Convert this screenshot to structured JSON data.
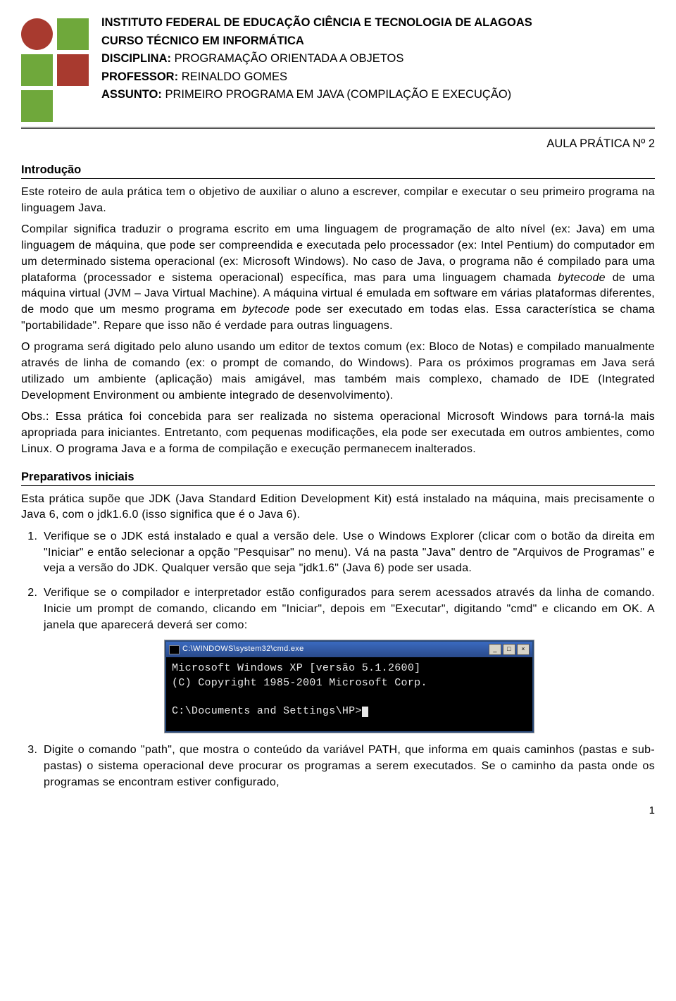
{
  "header": {
    "line1_bold": "INSTITUTO FEDERAL DE EDUCAÇÃO CIÊNCIA E TECNOLOGIA DE ALAGOAS",
    "line2_bold": "CURSO TÉCNICO EM INFORMÁTICA",
    "line3_label": "DISCIPLINA:",
    "line3_value": " PROGRAMAÇÃO ORIENTADA A OBJETOS",
    "line4_label": "PROFESSOR:",
    "line4_value": " REINALDO GOMES",
    "line5_label": "ASSUNTO:",
    "line5_value": " PRIMEIRO PROGRAMA EM JAVA (COMPILAÇÃO E EXECUÇÃO)"
  },
  "lesson_title": "AULA PRÁTICA Nº 2",
  "sections": {
    "intro_title": "Introdução",
    "intro_p1": "Este roteiro de aula prática tem o objetivo de auxiliar o aluno a escrever, compilar e executar o seu primeiro programa na linguagem Java.",
    "intro_p2a": "Compilar significa traduzir o programa escrito em uma linguagem de programação de alto nível (ex: Java) em uma linguagem de máquina, que pode ser compreendida e executada pelo processador (ex: Intel Pentium) do computador em um determinado sistema operacional (ex: Microsoft Windows). No caso de Java, o programa não é compilado para uma plataforma (processador e sistema operacional) específica, mas para uma linguagem chamada ",
    "intro_p2_ital1": "bytecode",
    "intro_p2b": " de uma máquina virtual (JVM – Java Virtual Machine). A máquina virtual é emulada em software em várias plataformas diferentes, de modo que um mesmo programa em ",
    "intro_p2_ital2": "bytecode",
    "intro_p2c": " pode ser executado em todas elas. Essa característica se chama \"portabilidade\". Repare que isso não é verdade para outras linguagens.",
    "intro_p3": "O programa será digitado pelo aluno usando um editor de textos comum (ex: Bloco de Notas) e compilado manualmente através de linha de comando (ex: o prompt de comando, do Windows). Para os próximos programas em Java será utilizado um ambiente (aplicação) mais amigável, mas também mais complexo, chamado de IDE (Integrated Development Environment ou ambiente integrado de desenvolvimento).",
    "intro_p4": "Obs.: Essa prática foi concebida para ser realizada no sistema operacional Microsoft Windows para torná-la mais apropriada para iniciantes. Entretanto, com pequenas modificações, ela pode ser executada em outros ambientes, como Linux. O programa Java e a forma de compilação e execução permanecem inalterados.",
    "prep_title": "Preparativos iniciais",
    "prep_p1": "Esta prática supõe que JDK (Java Standard Edition Development Kit) está instalado na máquina, mais precisamente o Java 6, com o jdk1.6.0 (isso significa que é o Java 6).",
    "step1": "Verifique se o JDK está instalado e qual a versão dele. Use o Windows Explorer (clicar com o botão da direita em \"Iniciar\" e então selecionar a opção \"Pesquisar\" no menu). Vá na pasta \"Java\" dentro de \"Arquivos de Programas\" e veja a versão do JDK. Qualquer versão que seja \"jdk1.6\" (Java 6) pode ser usada.",
    "step2": "Verifique se o compilador e interpretador estão configurados para serem acessados através da linha de comando. Inicie um prompt de comando, clicando em \"Iniciar\", depois em \"Executar\", digitando \"cmd\" e clicando em OK. A janela que aparecerá deverá ser como:",
    "step3": "Digite o comando \"path\", que mostra o conteúdo da variável PATH, que informa em quais caminhos (pastas e sub-pastas) o sistema operacional deve procurar os programas a serem executados. Se o caminho da pasta onde os programas se encontram estiver configurado,"
  },
  "cmd": {
    "title": "C:\\WINDOWS\\system32\\cmd.exe",
    "line1": "Microsoft Windows XP [versão 5.1.2600]",
    "line2": "(C) Copyright 1985-2001 Microsoft Corp.",
    "prompt": "C:\\Documents and Settings\\HP>"
  },
  "page_number": "1"
}
